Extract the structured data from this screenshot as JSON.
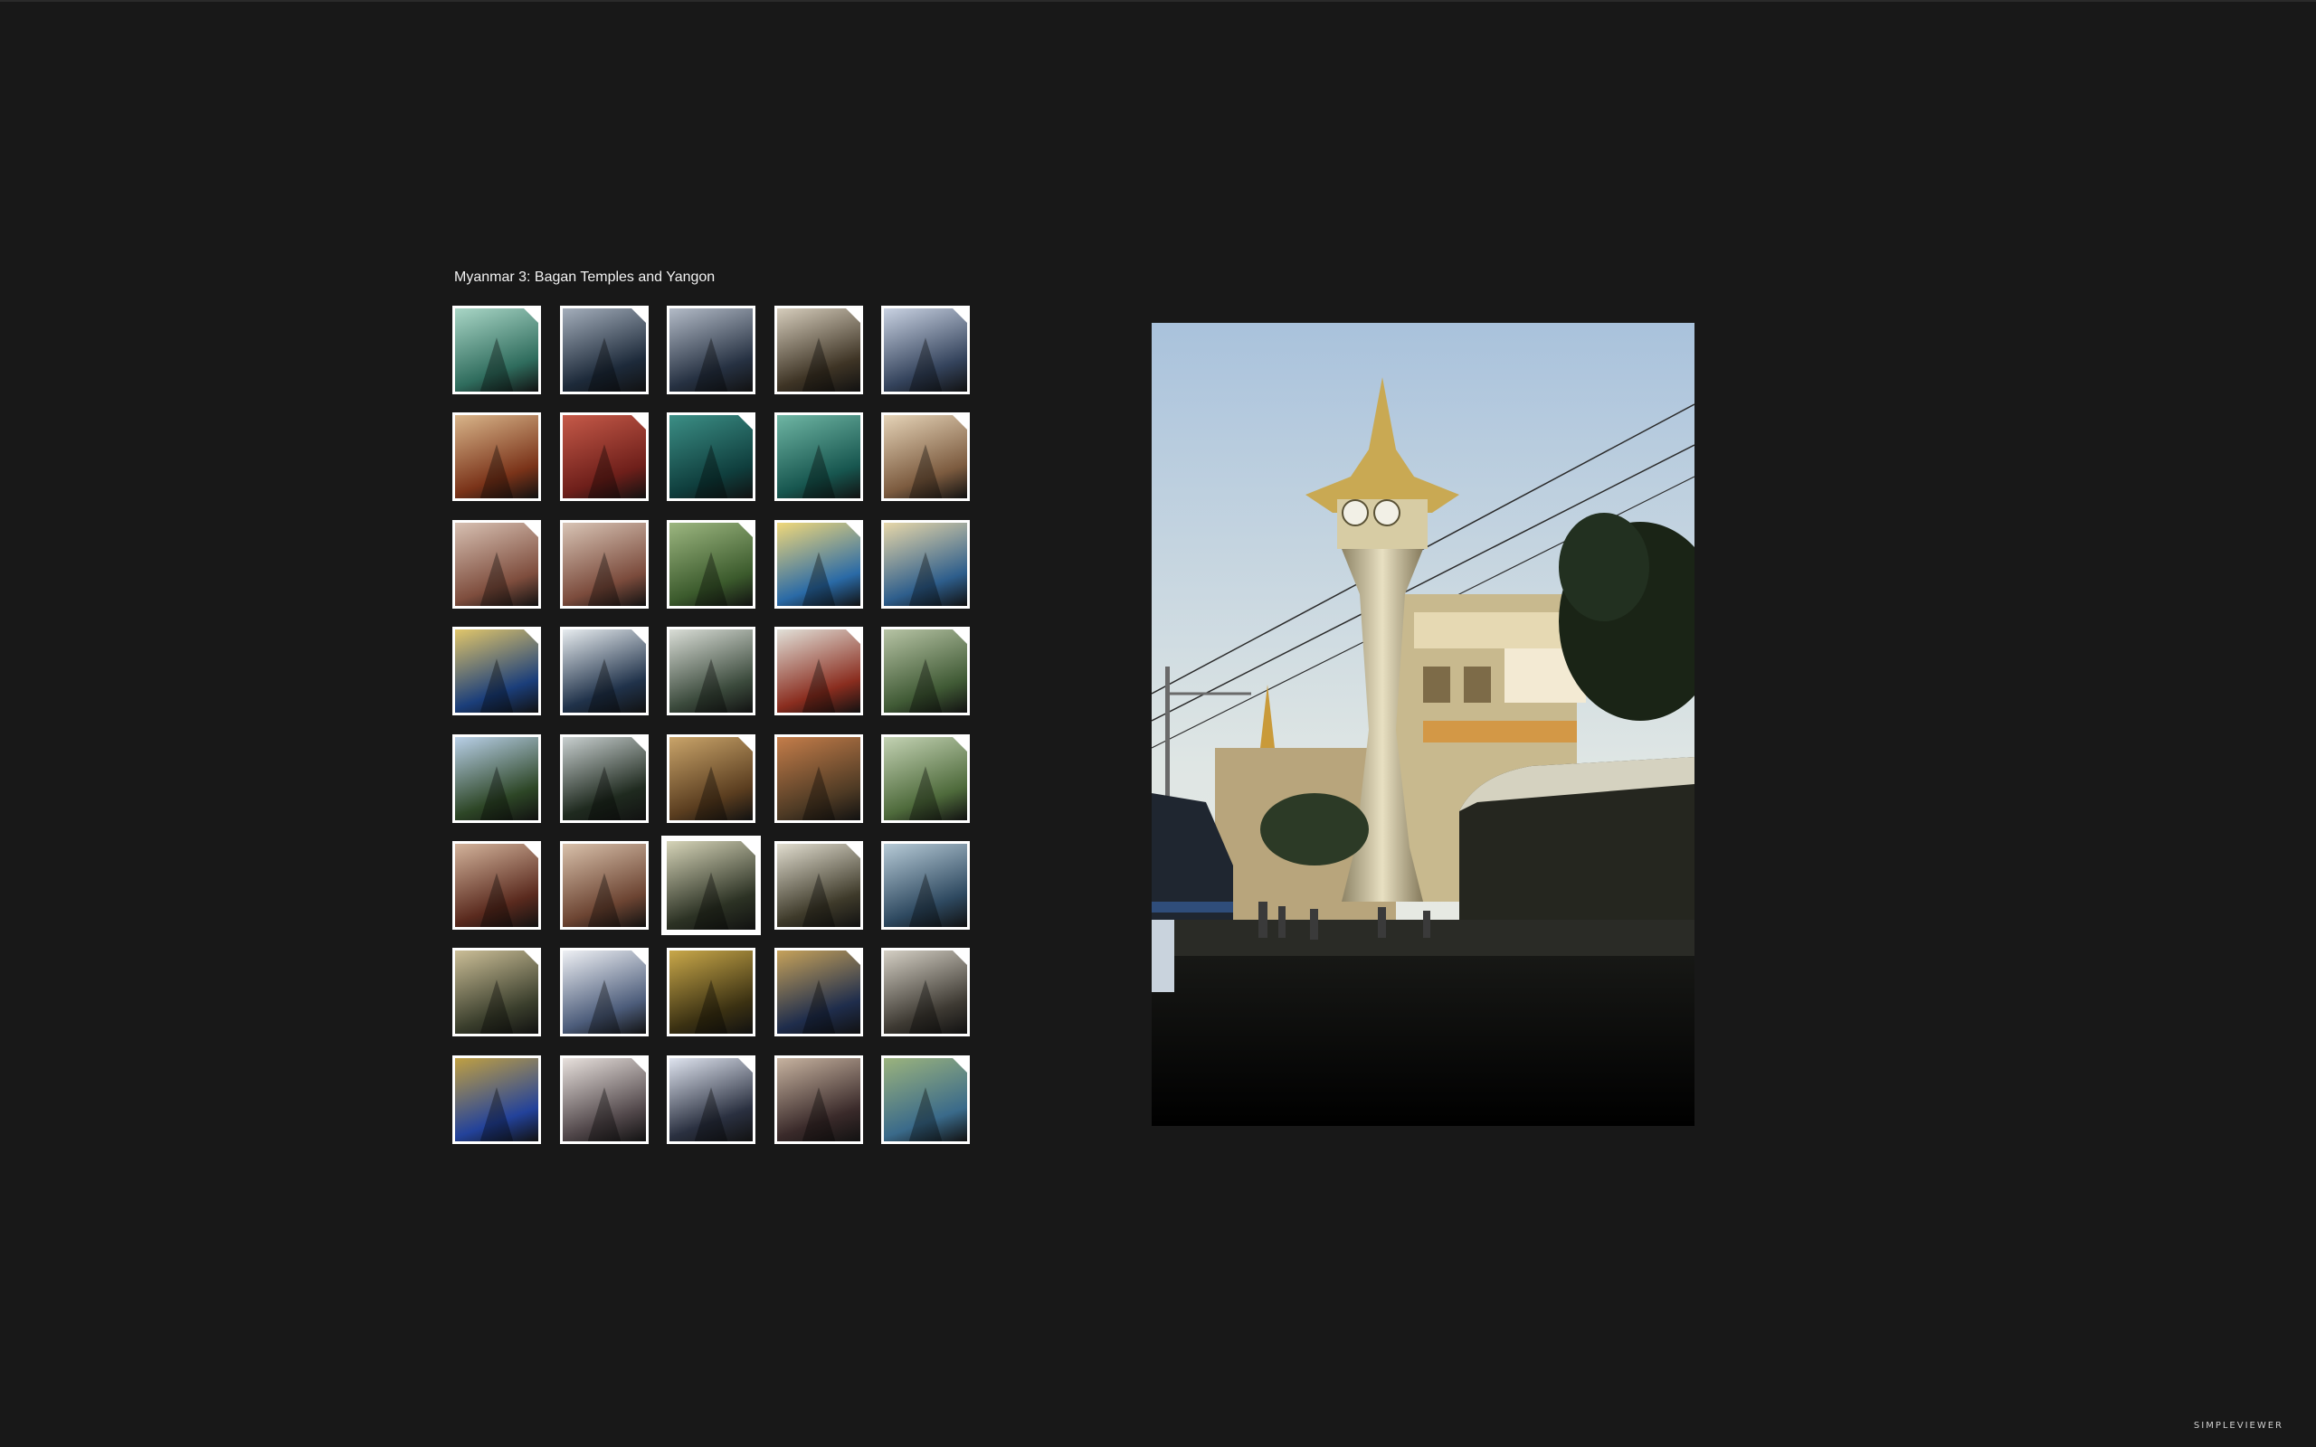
{
  "gallery": {
    "title": "Myanmar 3: Bagan Temples and Yangon",
    "selected_index": 27
  },
  "thumbnails": [
    {
      "name": "thumb-01",
      "icon": "jade-buddha-face-icon",
      "colors": [
        "#2f6c5d",
        "#a9d6c6"
      ]
    },
    {
      "name": "thumb-02",
      "icon": "temple-spire-icon",
      "colors": [
        "#1d2a3a",
        "#a4aebb"
      ]
    },
    {
      "name": "thumb-03",
      "icon": "temple-spire-icon",
      "colors": [
        "#263142",
        "#b3bbc7"
      ]
    },
    {
      "name": "thumb-04",
      "icon": "temple-spire-icon",
      "colors": [
        "#3e3425",
        "#d6cdbc"
      ]
    },
    {
      "name": "thumb-05",
      "icon": "temple-building-icon",
      "colors": [
        "#34435c",
        "#c9d2e2"
      ]
    },
    {
      "name": "thumb-06",
      "icon": "red-brick-temple-icon",
      "colors": [
        "#7a3319",
        "#d9b58a"
      ]
    },
    {
      "name": "thumb-07",
      "icon": "buddha-red-icon",
      "colors": [
        "#6e1f1a",
        "#c65a49"
      ]
    },
    {
      "name": "thumb-08",
      "icon": "buddha-green-icon",
      "colors": [
        "#0f3e3d",
        "#3c8f86"
      ]
    },
    {
      "name": "thumb-09",
      "icon": "buddha-green-icon",
      "colors": [
        "#17564f",
        "#6fb6a4"
      ]
    },
    {
      "name": "thumb-10",
      "icon": "pavilion-icon",
      "colors": [
        "#7c5b3f",
        "#e5d3b7"
      ]
    },
    {
      "name": "thumb-11",
      "icon": "long-hall-icon",
      "colors": [
        "#7e4d3d",
        "#d7c0b2"
      ]
    },
    {
      "name": "thumb-12",
      "icon": "long-hall-icon",
      "colors": [
        "#7b4b3c",
        "#d8c4b5"
      ]
    },
    {
      "name": "thumb-13",
      "icon": "trees-icon",
      "colors": [
        "#3b5a2c",
        "#9cb680"
      ]
    },
    {
      "name": "thumb-14",
      "icon": "golden-stupa-icon",
      "colors": [
        "#2a6aa6",
        "#f0d87a"
      ]
    },
    {
      "name": "thumb-15",
      "icon": "golden-stupa-icon",
      "colors": [
        "#2e5e8c",
        "#e7d7a9"
      ]
    },
    {
      "name": "thumb-16",
      "icon": "golden-stupa-icon",
      "colors": [
        "#1b3e7a",
        "#e1c66a"
      ]
    },
    {
      "name": "thumb-17",
      "icon": "white-stupa-icon",
      "colors": [
        "#20324a",
        "#e7ecef"
      ]
    },
    {
      "name": "thumb-18",
      "icon": "white-stupa-icon",
      "colors": [
        "#3b4a3c",
        "#d9ddd6"
      ]
    },
    {
      "name": "thumb-19",
      "icon": "monks-icon",
      "colors": [
        "#8a2d1f",
        "#e2e0d8"
      ]
    },
    {
      "name": "thumb-20",
      "icon": "field-temple-icon",
      "colors": [
        "#405a35",
        "#b6c3a4"
      ]
    },
    {
      "name": "thumb-21",
      "icon": "trees-icon",
      "colors": [
        "#2d4626",
        "#b9d0e8"
      ]
    },
    {
      "name": "thumb-22",
      "icon": "temple-spire-icon",
      "colors": [
        "#1f2a1f",
        "#c8cfcf"
      ]
    },
    {
      "name": "thumb-23",
      "icon": "ornate-temple-icon",
      "colors": [
        "#5a3d1f",
        "#c9a46a"
      ]
    },
    {
      "name": "thumb-24",
      "icon": "red-brick-temple-icon",
      "colors": [
        "#4e3a24",
        "#c47d4a"
      ]
    },
    {
      "name": "thumb-25",
      "icon": "field-temple-icon",
      "colors": [
        "#4e6a3b",
        "#c3d2b3"
      ]
    },
    {
      "name": "thumb-26",
      "icon": "red-brick-temple-icon",
      "colors": [
        "#5a2a1e",
        "#d3b39b"
      ]
    },
    {
      "name": "thumb-27",
      "icon": "stupa-brick-icon",
      "colors": [
        "#6c4432",
        "#d8c0aa"
      ]
    },
    {
      "name": "thumb-28",
      "icon": "clock-tower-icon",
      "colors": [
        "#2c3224",
        "#d6d4b8"
      ]
    },
    {
      "name": "thumb-29",
      "icon": "golden-stupa-icon",
      "colors": [
        "#3e3a2a",
        "#e1ddcf"
      ]
    },
    {
      "name": "thumb-30",
      "icon": "golden-stupa-icon",
      "colors": [
        "#2e4960",
        "#b6cad6"
      ]
    },
    {
      "name": "thumb-31",
      "icon": "golden-stupa-icon",
      "colors": [
        "#3a3e2c",
        "#cbbe97"
      ]
    },
    {
      "name": "thumb-32",
      "icon": "white-stupa-icon",
      "colors": [
        "#4c5c7a",
        "#eef0f4"
      ]
    },
    {
      "name": "thumb-33",
      "icon": "golden-stupa-icon",
      "colors": [
        "#3b3112",
        "#c9a84a"
      ]
    },
    {
      "name": "thumb-34",
      "icon": "golden-stupa-icon",
      "colors": [
        "#1f2d4c",
        "#c6a25a"
      ]
    },
    {
      "name": "thumb-35",
      "icon": "stupa-skyline-icon",
      "colors": [
        "#3e3a33",
        "#d4cfc4"
      ]
    },
    {
      "name": "thumb-36",
      "icon": "golden-stupa-icon",
      "colors": [
        "#23429a",
        "#c0a042"
      ]
    },
    {
      "name": "thumb-37",
      "icon": "buddha-statue-icon",
      "colors": [
        "#51474a",
        "#e8e1dd"
      ]
    },
    {
      "name": "thumb-38",
      "icon": "reclining-buddha-icon",
      "colors": [
        "#2a3040",
        "#dfe4ef"
      ]
    },
    {
      "name": "thumb-39",
      "icon": "colorful-murals-icon",
      "colors": [
        "#3a2a2a",
        "#c7b3a0"
      ]
    },
    {
      "name": "thumb-40",
      "icon": "landscape-icon",
      "colors": [
        "#3a6a8a",
        "#9bb37d"
      ]
    }
  ],
  "main_image": {
    "icon": "clock-tower-photo",
    "sky_colors": [
      "#c7d8ea",
      "#eef0e8"
    ]
  },
  "footer": {
    "brand": "SIMPLEVIEWER"
  }
}
